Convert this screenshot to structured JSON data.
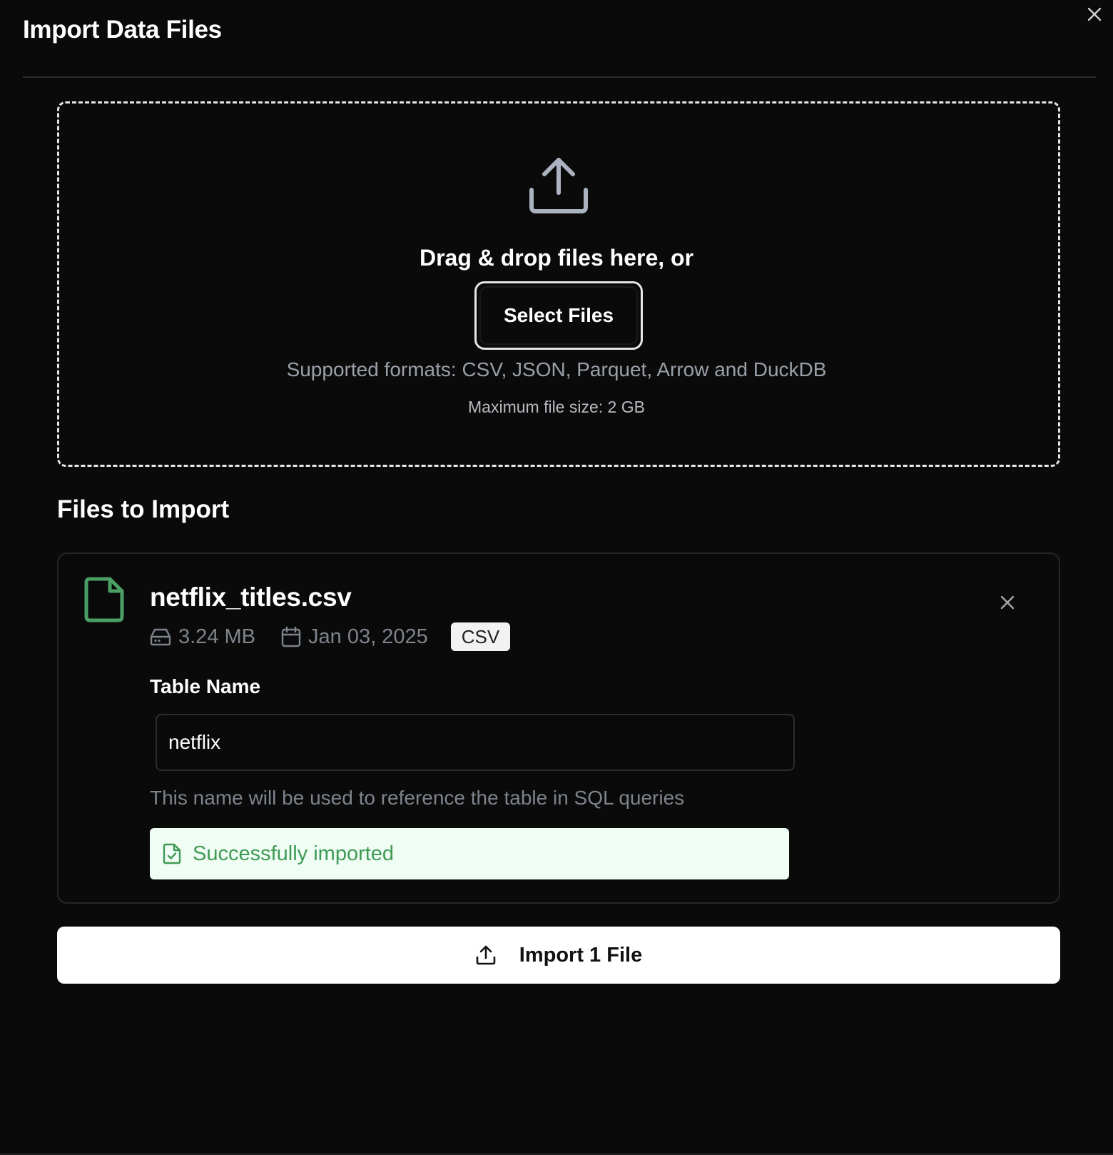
{
  "dialog": {
    "title": "Import Data Files",
    "close_icon": "close-icon"
  },
  "dropzone": {
    "icon": "upload-icon",
    "prompt": "Drag & drop files here, or",
    "select_button_label": "Select Files",
    "supported_formats": "Supported formats: CSV, JSON, Parquet, Arrow and DuckDB",
    "max_size": "Maximum file size: 2 GB"
  },
  "files_section": {
    "title": "Files to Import",
    "files": [
      {
        "icon": "file-icon",
        "name": "netflix_titles.csv",
        "size": "3.24 MB",
        "date": "Jan 03, 2025",
        "format_badge": "CSV",
        "table_name_label": "Table Name",
        "table_name_value": "netflix",
        "table_name_hint": "This name will be used to reference the table in SQL queries",
        "status": "Successfully imported"
      }
    ]
  },
  "actions": {
    "import_button_label": "Import 1 File"
  },
  "colors": {
    "background": "#0a0a0a",
    "success_bg": "#f0fdf4",
    "success_text": "#3f9a55",
    "file_icon": "#4a9f64",
    "muted_text": "#7e848c"
  }
}
